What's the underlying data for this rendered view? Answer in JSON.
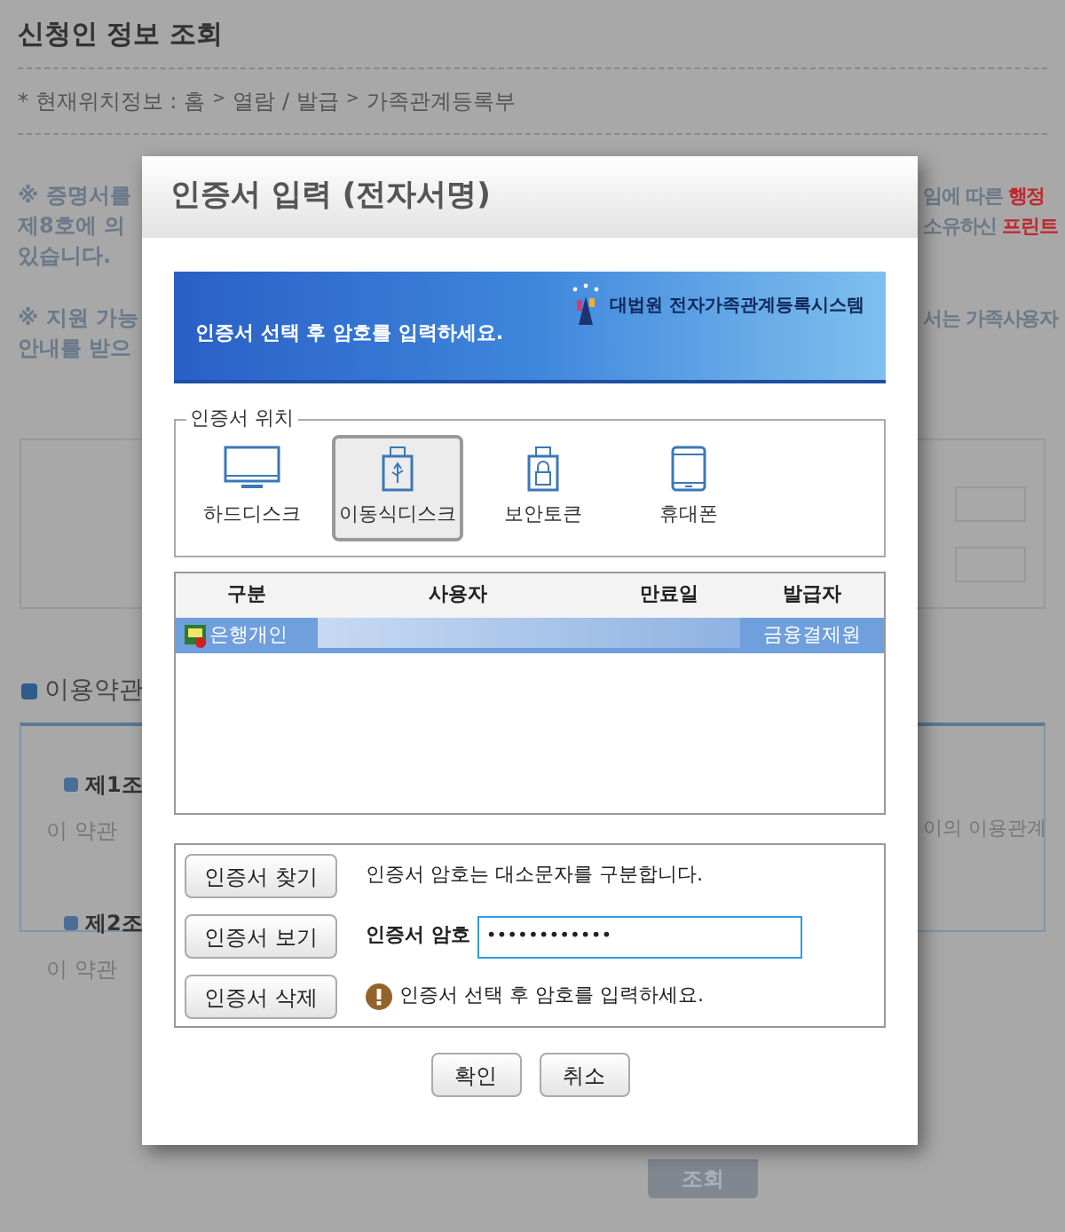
{
  "page": {
    "title": "신청인 정보 조회",
    "breadcrumb": {
      "prefix": "* 현재위치정보 :",
      "separator": ">",
      "items": [
        "홈",
        "열람 / 발급",
        "가족관계등록부"
      ]
    },
    "notice_1": {
      "left": [
        "※ 증명서를",
        "제8호에 의",
        "있습니다."
      ],
      "right": [
        {
          "text": "임에 따른",
          "highlight": "행정"
        },
        {
          "text": "소유하신",
          "highlight": "프린트"
        }
      ]
    },
    "notice_2": {
      "left": [
        "※ 지원 가능",
        "안내를 받으"
      ],
      "right": [
        "서는 가족사용자"
      ]
    },
    "terms": {
      "heading": "이용약관",
      "articles": [
        {
          "title": "제1조",
          "body": "이 약관",
          "body_right": "이의 이용관계"
        },
        {
          "title": "제2조",
          "body": "이 약관"
        }
      ]
    },
    "search_button": "조회"
  },
  "dialog": {
    "title": "인증서 입력 (전자서명)",
    "banner": {
      "message": "인증서 선택 후 암호를 입력하세요.",
      "system_name": "대법원 전자가족관계등록시스템"
    },
    "location": {
      "legend": "인증서 위치",
      "options": [
        {
          "kind": "monitor",
          "label": "하드디스크",
          "selected": false
        },
        {
          "kind": "usb",
          "label": "이동식디스크",
          "selected": true
        },
        {
          "kind": "token",
          "label": "보안토큰",
          "selected": false
        },
        {
          "kind": "phone",
          "label": "휴대폰",
          "selected": false
        }
      ]
    },
    "table": {
      "columns": [
        "구분",
        "사용자",
        "만료일",
        "발급자"
      ],
      "rows": [
        {
          "type": "은행개인",
          "issuer": "금융결제원",
          "selected": true
        }
      ]
    },
    "actions": {
      "buttons": [
        "인증서 찾기",
        "인증서 보기",
        "인증서 삭제"
      ],
      "case_note": "인증서 암호는 대소문자를 구분합니다.",
      "password": {
        "label": "인증서 암호",
        "value": "••••••••••••"
      },
      "hint": "인증서 선택 후 암호를 입력하세요."
    },
    "footer_buttons": [
      "확인",
      "취소"
    ]
  }
}
